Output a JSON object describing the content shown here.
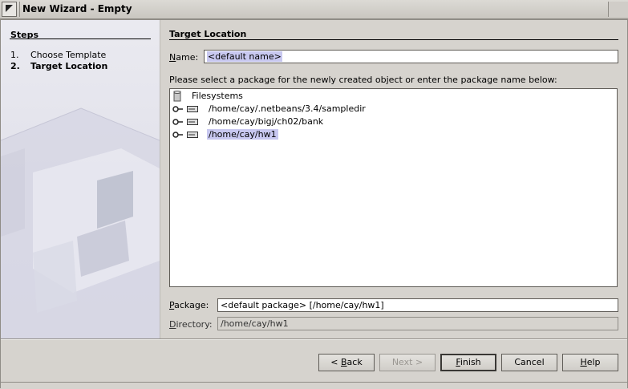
{
  "window": {
    "title": "New Wizard - Empty"
  },
  "steps": {
    "title": "Steps",
    "items": [
      {
        "num": "1.",
        "label": "Choose Template"
      },
      {
        "num": "2.",
        "label": "Target Location"
      }
    ]
  },
  "section": {
    "title": "Target Location"
  },
  "name": {
    "label_first": "N",
    "label_rest": "ame:",
    "value": "<default name>"
  },
  "instruction": "Please select a package for the newly created object or enter the package name below:",
  "tree": {
    "root": "Filesystems",
    "items": [
      {
        "label": "/home/cay/.netbeans/3.4/sampledir",
        "selected": false
      },
      {
        "label": "/home/cay/bigj/ch02/bank",
        "selected": false
      },
      {
        "label": "/home/cay/hw1",
        "selected": true
      }
    ]
  },
  "package": {
    "label_first": "P",
    "label_rest": "ackage:",
    "value": "<default package> [/home/cay/hw1]"
  },
  "directory": {
    "label_first": "D",
    "label_rest": "irectory:",
    "value": "/home/cay/hw1"
  },
  "buttons": {
    "back_prefix": "< ",
    "back_u": "B",
    "back_rest": "ack",
    "next": "Next >",
    "finish_u": "F",
    "finish_rest": "inish",
    "cancel": "Cancel",
    "help_u": "H",
    "help_rest": "elp"
  },
  "colors": {
    "selection": "#c8c8f0",
    "background": "#d6d3ce"
  }
}
